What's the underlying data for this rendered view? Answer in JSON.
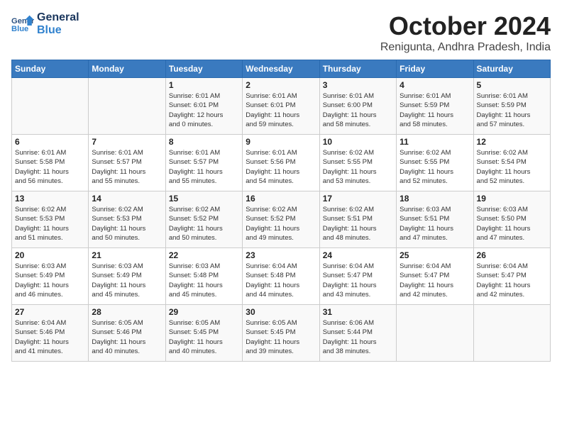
{
  "header": {
    "logo_line1": "General",
    "logo_line2": "Blue",
    "month": "October 2024",
    "location": "Renigunta, Andhra Pradesh, India"
  },
  "days_of_week": [
    "Sunday",
    "Monday",
    "Tuesday",
    "Wednesday",
    "Thursday",
    "Friday",
    "Saturday"
  ],
  "weeks": [
    [
      {
        "day": "",
        "info": ""
      },
      {
        "day": "",
        "info": ""
      },
      {
        "day": "1",
        "info": "Sunrise: 6:01 AM\nSunset: 6:01 PM\nDaylight: 12 hours\nand 0 minutes."
      },
      {
        "day": "2",
        "info": "Sunrise: 6:01 AM\nSunset: 6:01 PM\nDaylight: 11 hours\nand 59 minutes."
      },
      {
        "day": "3",
        "info": "Sunrise: 6:01 AM\nSunset: 6:00 PM\nDaylight: 11 hours\nand 58 minutes."
      },
      {
        "day": "4",
        "info": "Sunrise: 6:01 AM\nSunset: 5:59 PM\nDaylight: 11 hours\nand 58 minutes."
      },
      {
        "day": "5",
        "info": "Sunrise: 6:01 AM\nSunset: 5:59 PM\nDaylight: 11 hours\nand 57 minutes."
      }
    ],
    [
      {
        "day": "6",
        "info": "Sunrise: 6:01 AM\nSunset: 5:58 PM\nDaylight: 11 hours\nand 56 minutes."
      },
      {
        "day": "7",
        "info": "Sunrise: 6:01 AM\nSunset: 5:57 PM\nDaylight: 11 hours\nand 55 minutes."
      },
      {
        "day": "8",
        "info": "Sunrise: 6:01 AM\nSunset: 5:57 PM\nDaylight: 11 hours\nand 55 minutes."
      },
      {
        "day": "9",
        "info": "Sunrise: 6:01 AM\nSunset: 5:56 PM\nDaylight: 11 hours\nand 54 minutes."
      },
      {
        "day": "10",
        "info": "Sunrise: 6:02 AM\nSunset: 5:55 PM\nDaylight: 11 hours\nand 53 minutes."
      },
      {
        "day": "11",
        "info": "Sunrise: 6:02 AM\nSunset: 5:55 PM\nDaylight: 11 hours\nand 52 minutes."
      },
      {
        "day": "12",
        "info": "Sunrise: 6:02 AM\nSunset: 5:54 PM\nDaylight: 11 hours\nand 52 minutes."
      }
    ],
    [
      {
        "day": "13",
        "info": "Sunrise: 6:02 AM\nSunset: 5:53 PM\nDaylight: 11 hours\nand 51 minutes."
      },
      {
        "day": "14",
        "info": "Sunrise: 6:02 AM\nSunset: 5:53 PM\nDaylight: 11 hours\nand 50 minutes."
      },
      {
        "day": "15",
        "info": "Sunrise: 6:02 AM\nSunset: 5:52 PM\nDaylight: 11 hours\nand 50 minutes."
      },
      {
        "day": "16",
        "info": "Sunrise: 6:02 AM\nSunset: 5:52 PM\nDaylight: 11 hours\nand 49 minutes."
      },
      {
        "day": "17",
        "info": "Sunrise: 6:02 AM\nSunset: 5:51 PM\nDaylight: 11 hours\nand 48 minutes."
      },
      {
        "day": "18",
        "info": "Sunrise: 6:03 AM\nSunset: 5:51 PM\nDaylight: 11 hours\nand 47 minutes."
      },
      {
        "day": "19",
        "info": "Sunrise: 6:03 AM\nSunset: 5:50 PM\nDaylight: 11 hours\nand 47 minutes."
      }
    ],
    [
      {
        "day": "20",
        "info": "Sunrise: 6:03 AM\nSunset: 5:49 PM\nDaylight: 11 hours\nand 46 minutes."
      },
      {
        "day": "21",
        "info": "Sunrise: 6:03 AM\nSunset: 5:49 PM\nDaylight: 11 hours\nand 45 minutes."
      },
      {
        "day": "22",
        "info": "Sunrise: 6:03 AM\nSunset: 5:48 PM\nDaylight: 11 hours\nand 45 minutes."
      },
      {
        "day": "23",
        "info": "Sunrise: 6:04 AM\nSunset: 5:48 PM\nDaylight: 11 hours\nand 44 minutes."
      },
      {
        "day": "24",
        "info": "Sunrise: 6:04 AM\nSunset: 5:47 PM\nDaylight: 11 hours\nand 43 minutes."
      },
      {
        "day": "25",
        "info": "Sunrise: 6:04 AM\nSunset: 5:47 PM\nDaylight: 11 hours\nand 42 minutes."
      },
      {
        "day": "26",
        "info": "Sunrise: 6:04 AM\nSunset: 5:47 PM\nDaylight: 11 hours\nand 42 minutes."
      }
    ],
    [
      {
        "day": "27",
        "info": "Sunrise: 6:04 AM\nSunset: 5:46 PM\nDaylight: 11 hours\nand 41 minutes."
      },
      {
        "day": "28",
        "info": "Sunrise: 6:05 AM\nSunset: 5:46 PM\nDaylight: 11 hours\nand 40 minutes."
      },
      {
        "day": "29",
        "info": "Sunrise: 6:05 AM\nSunset: 5:45 PM\nDaylight: 11 hours\nand 40 minutes."
      },
      {
        "day": "30",
        "info": "Sunrise: 6:05 AM\nSunset: 5:45 PM\nDaylight: 11 hours\nand 39 minutes."
      },
      {
        "day": "31",
        "info": "Sunrise: 6:06 AM\nSunset: 5:44 PM\nDaylight: 11 hours\nand 38 minutes."
      },
      {
        "day": "",
        "info": ""
      },
      {
        "day": "",
        "info": ""
      }
    ]
  ]
}
